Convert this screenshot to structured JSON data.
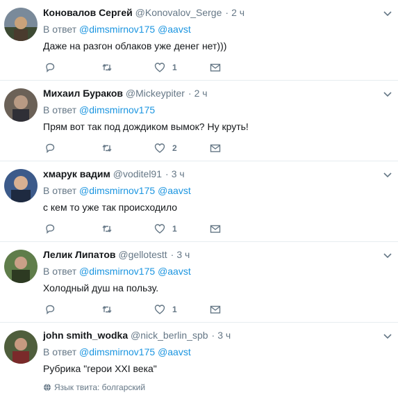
{
  "reply_prefix": "В ответ",
  "tweets": [
    {
      "fullname": "Коновалов Сергей",
      "username": "@Konovalov_Serge",
      "dot": "·",
      "time": "2 ч",
      "mentions": [
        "@dimsmirnov175",
        "@aavst"
      ],
      "text": "Даже на разгон облаков уже денег нет)))",
      "likes": "1"
    },
    {
      "fullname": "Михаил Бураков",
      "username": "@Mickeypiter",
      "dot": "·",
      "time": "2 ч",
      "mentions": [
        "@dimsmirnov175"
      ],
      "text": "Прям вот так под дождиком вымок? Ну круть!",
      "likes": "2"
    },
    {
      "fullname": "хмарук вадим",
      "username": "@voditel91",
      "dot": "·",
      "time": "3 ч",
      "mentions": [
        "@dimsmirnov175",
        "@aavst"
      ],
      "text": "с кем то уже так происходило",
      "likes": "1"
    },
    {
      "fullname": "Лелик Липатов",
      "username": "@gellotestt",
      "dot": "·",
      "time": "3 ч",
      "mentions": [
        "@dimsmirnov175",
        "@aavst"
      ],
      "text": "Холодный душ на пользу.",
      "likes": "1"
    },
    {
      "fullname": "john smith_wodka",
      "username": "@nick_berlin_spb",
      "dot": "·",
      "time": "3 ч",
      "mentions": [
        "@dimsmirnov175",
        "@aavst"
      ],
      "text": "Рубрика \"герои XXI века\"",
      "tweet_language": "Язык твита: болгарский"
    }
  ],
  "colors": {
    "link": "#1b95e0",
    "secondary_text": "#657786",
    "divider": "#e6ecf0"
  }
}
